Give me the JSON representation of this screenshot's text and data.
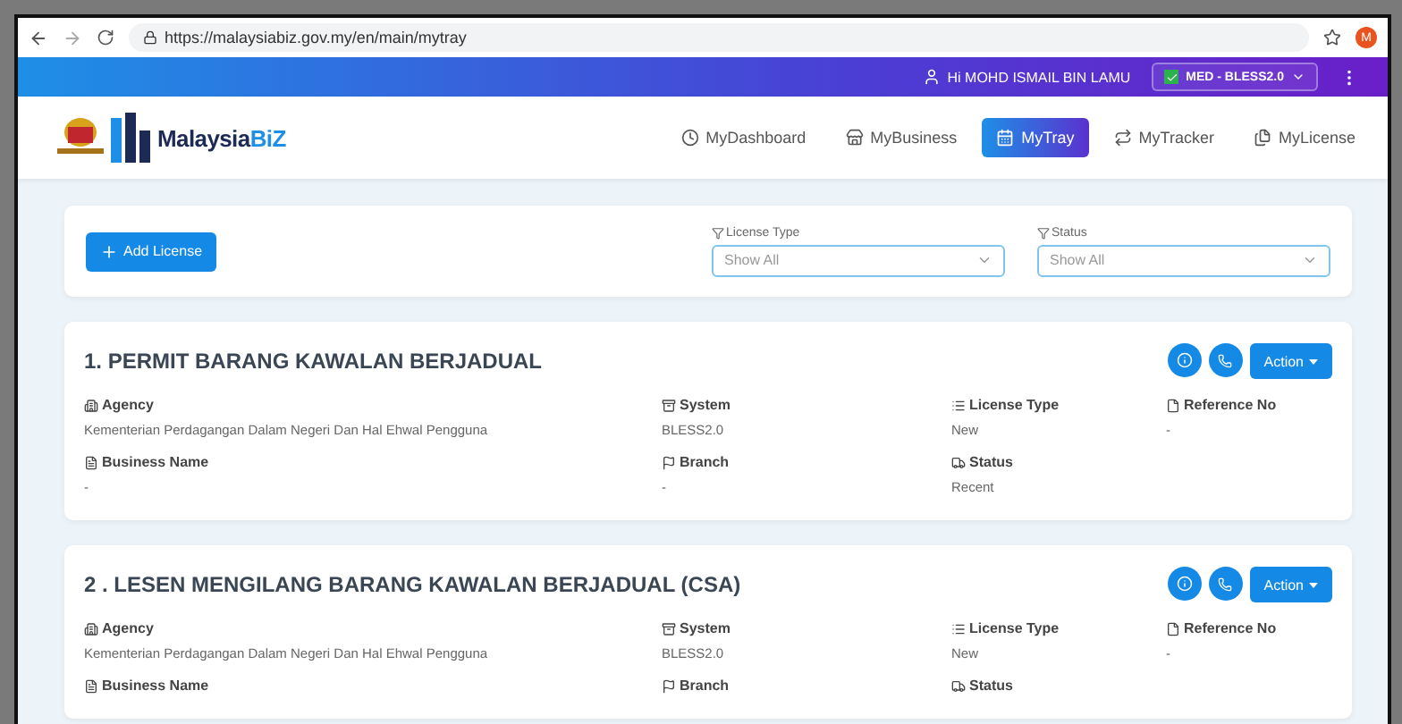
{
  "browser": {
    "url": "https://malaysiabiz.gov.my/en/main/mytray",
    "profile_initial": "M"
  },
  "topbar": {
    "greeting": "Hi MOHD ISMAIL BIN LAMU",
    "account": {
      "label": "MED - BLESS2.0",
      "checked": true
    }
  },
  "logo": {
    "text": "Malaysia",
    "accent": "BiZ"
  },
  "nav": [
    {
      "label": "MyDashboard",
      "kind": "dashboard",
      "selected": false
    },
    {
      "label": "MyBusiness",
      "kind": "business",
      "selected": false
    },
    {
      "label": "MyTray",
      "kind": "tray",
      "selected": true
    },
    {
      "label": "MyTracker",
      "kind": "tracker",
      "selected": false
    },
    {
      "label": "MyLicense",
      "kind": "license",
      "selected": false
    }
  ],
  "toolbar": {
    "add_button": "Add License",
    "filters": [
      {
        "label": "License Type",
        "placeholder": "Show All"
      },
      {
        "label": "Status",
        "placeholder": "Show All"
      }
    ]
  },
  "licenses": [
    {
      "title": "1. PERMIT BARANG KAWALAN BERJADUAL",
      "action": "Action",
      "fields": [
        {
          "kind": "agency",
          "label": "Agency",
          "value": "Kementerian Perdagangan Dalam Negeri Dan Hal Ehwal Pengguna"
        },
        {
          "kind": "system",
          "label": "System",
          "value": "BLESS2.0"
        },
        {
          "kind": "type",
          "label": "License Type",
          "value": "New"
        },
        {
          "kind": "reference",
          "label": "Reference No",
          "value": "-"
        },
        {
          "kind": "business",
          "label": "Business Name",
          "value": "-"
        },
        {
          "kind": "branch",
          "label": "Branch",
          "value": "-"
        },
        {
          "kind": "status",
          "label": "Status",
          "value": "Recent"
        }
      ]
    },
    {
      "title": "2 . LESEN MENGILANG BARANG KAWALAN BERJADUAL (CSA)",
      "action": "Action",
      "fields": [
        {
          "kind": "agency",
          "label": "Agency",
          "value": "Kementerian Perdagangan Dalam Negeri Dan Hal Ehwal Pengguna"
        },
        {
          "kind": "system",
          "label": "System",
          "value": "BLESS2.0"
        },
        {
          "kind": "type",
          "label": "License Type",
          "value": "New"
        },
        {
          "kind": "reference",
          "label": "Reference No",
          "value": "-"
        },
        {
          "kind": "business",
          "label": "Business Name"
        },
        {
          "kind": "branch",
          "label": "Branch"
        },
        {
          "kind": "status",
          "label": "Status"
        }
      ]
    }
  ]
}
